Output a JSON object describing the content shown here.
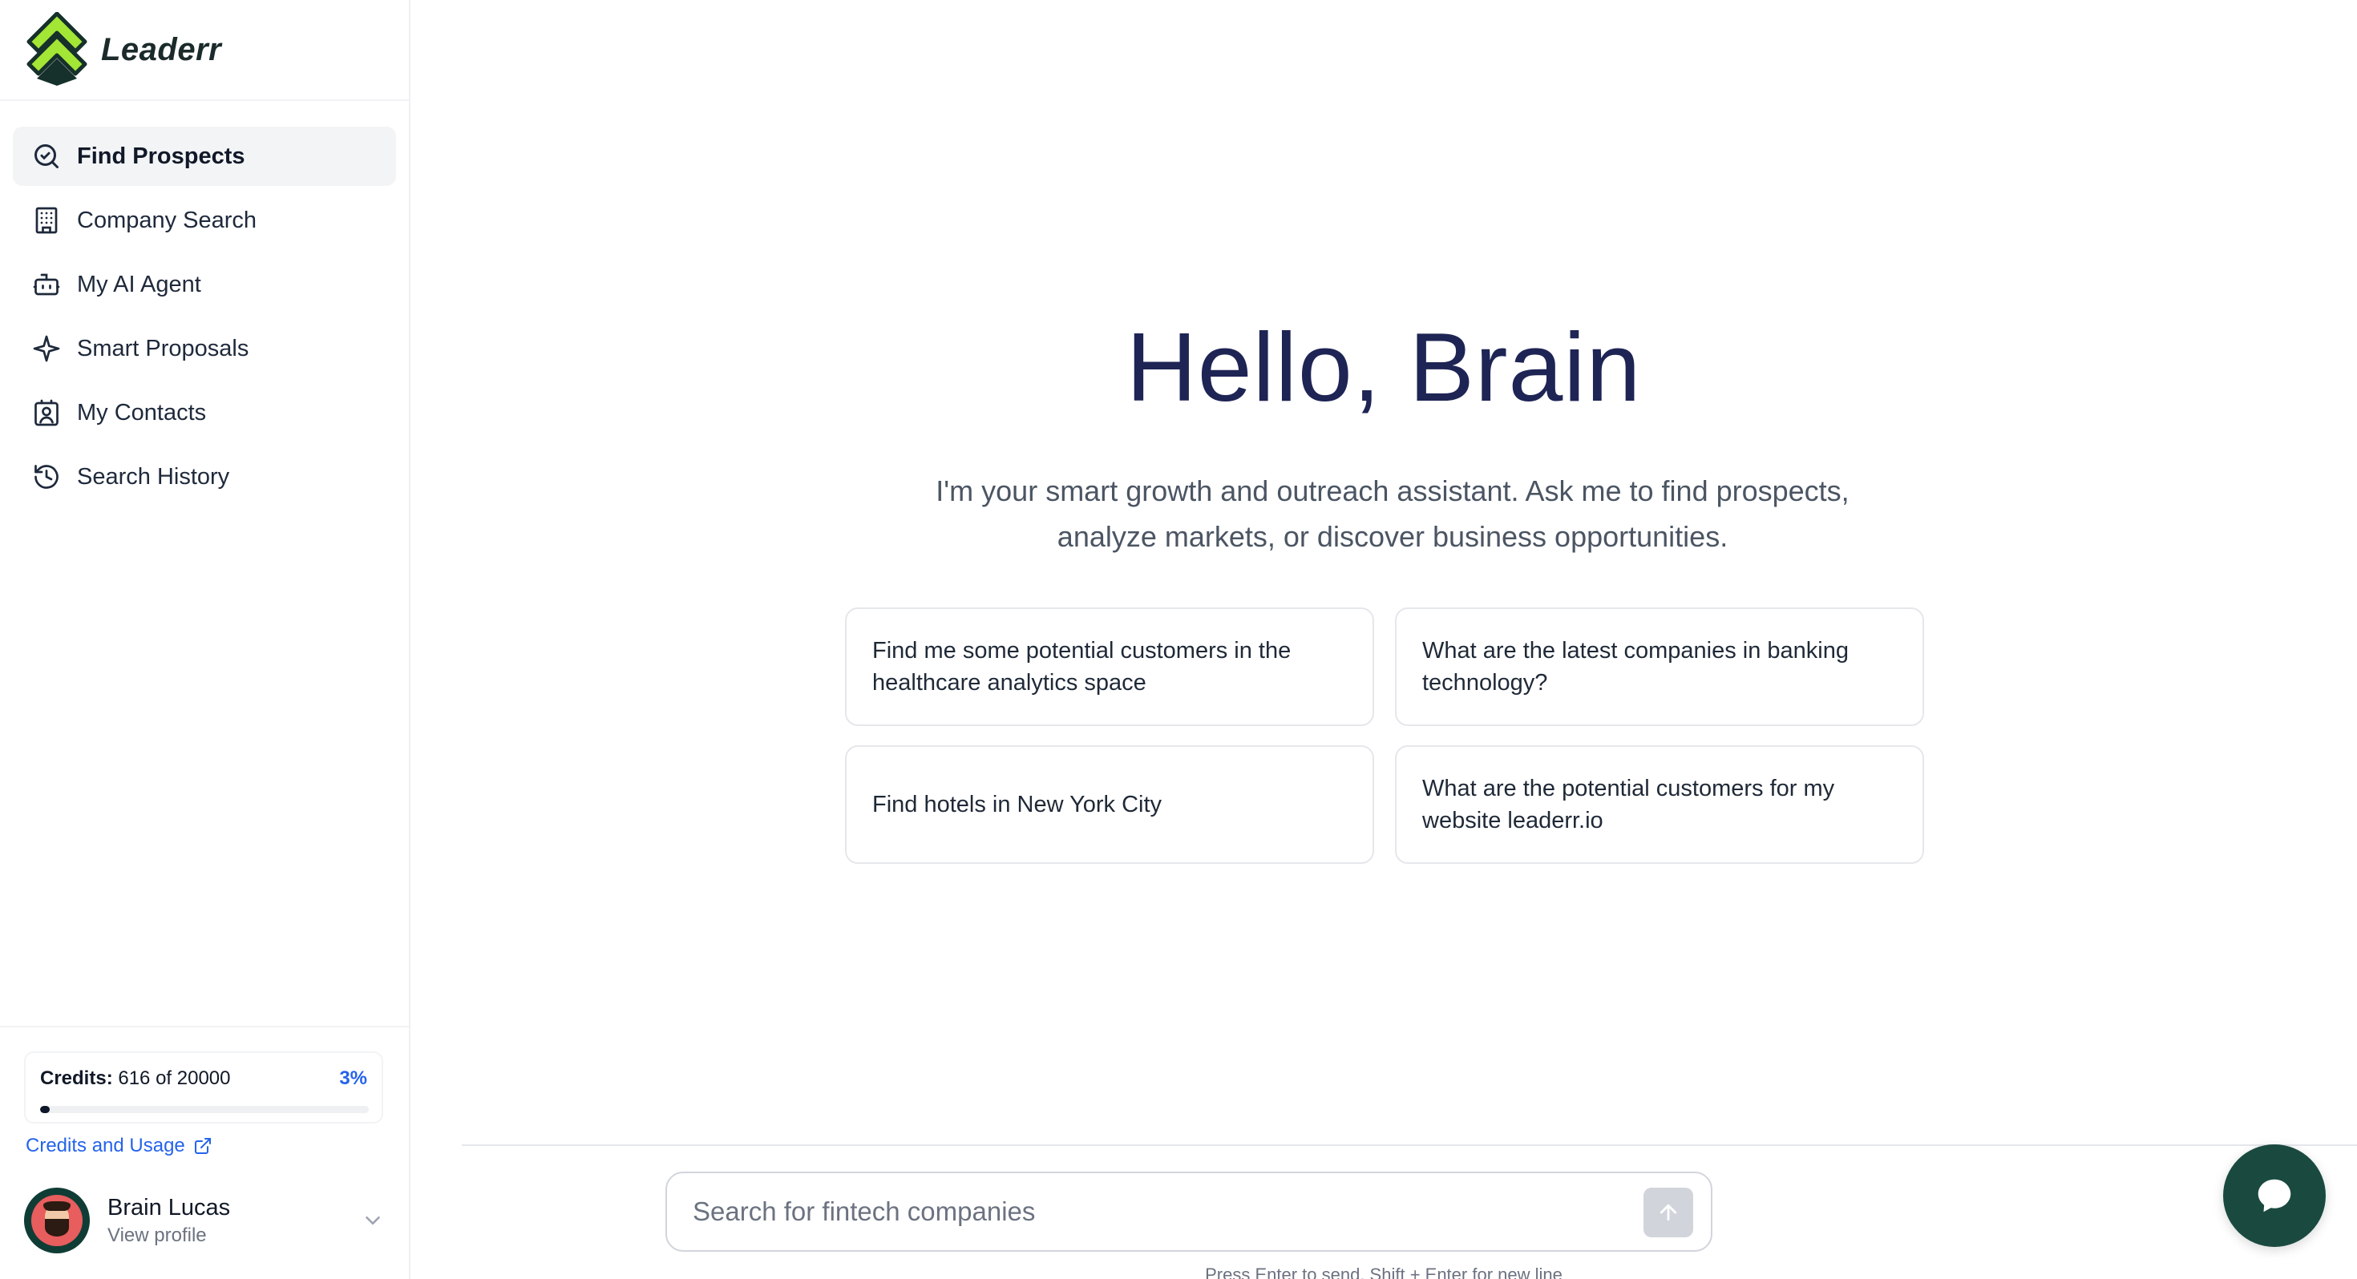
{
  "brand": {
    "name": "Leaderr",
    "accent": "#a3e635",
    "dark": "#1a4a3f"
  },
  "nav": {
    "items": [
      {
        "label": "Find Prospects",
        "icon": "search-magnify-icon",
        "active": true
      },
      {
        "label": "Company Search",
        "icon": "building-icon",
        "active": false
      },
      {
        "label": "My AI Agent",
        "icon": "robot-icon",
        "active": false
      },
      {
        "label": "Smart Proposals",
        "icon": "sparkle-icon",
        "active": false
      },
      {
        "label": "My Contacts",
        "icon": "contact-card-icon",
        "active": false
      },
      {
        "label": "Search History",
        "icon": "history-icon",
        "active": false
      }
    ]
  },
  "credits": {
    "label": "Credits:",
    "value": "616 of 20000",
    "percent": "3%",
    "fraction": 0.03,
    "link_label": "Credits and Usage"
  },
  "profile": {
    "name": "Brain Lucas",
    "sub": "View profile"
  },
  "main": {
    "greeting": "Hello, Brain",
    "subtitle_line1": "I'm your smart growth and outreach assistant. Ask me to find prospects,",
    "subtitle_line2": "analyze markets, or discover business opportunities.",
    "suggestions": [
      "Find me some potential customers in the healthcare analytics space",
      "What are the latest companies in banking technology?",
      "Find hotels in New York City",
      "What are the potential customers for my website leaderr.io"
    ]
  },
  "search": {
    "placeholder": "Search for fintech companies",
    "value": "",
    "hint": "Press Enter to send, Shift + Enter for new line"
  }
}
